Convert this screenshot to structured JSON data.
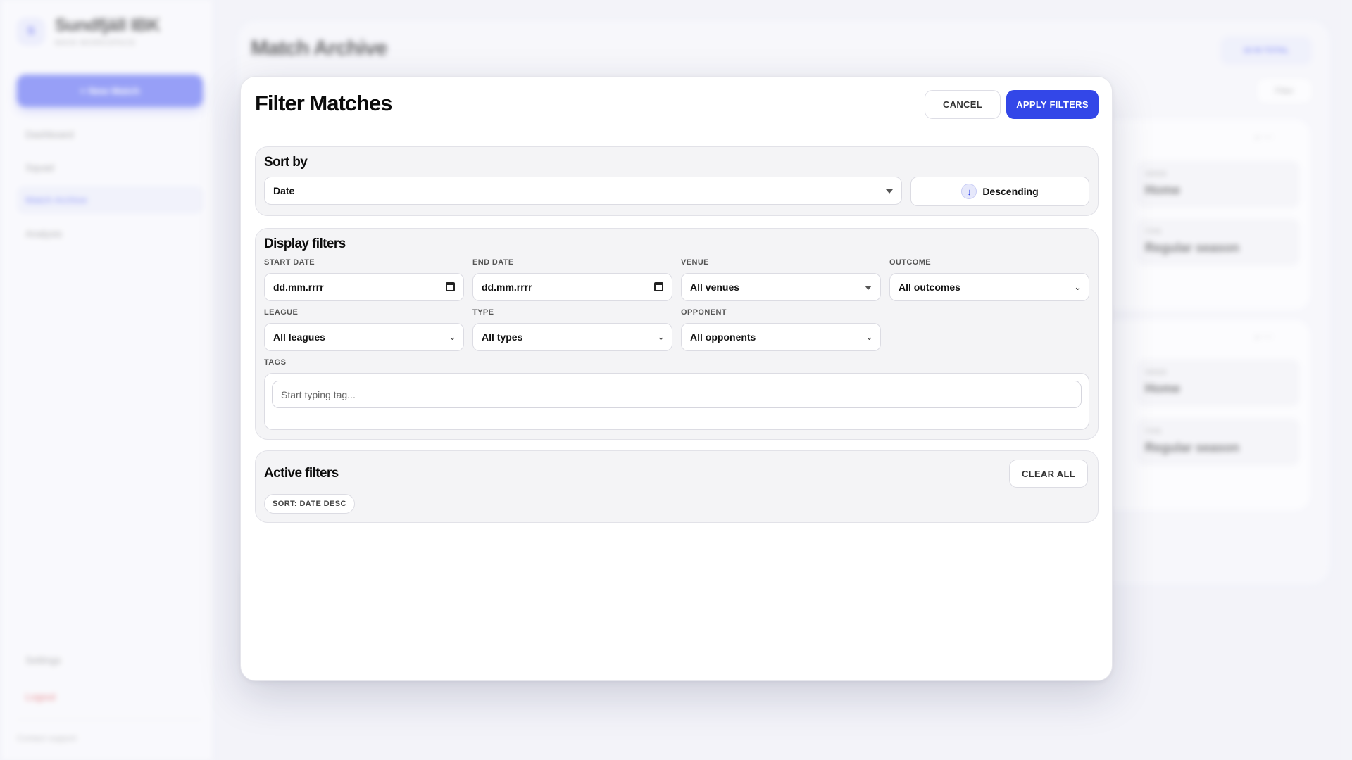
{
  "sidebar": {
    "brand_initial": "S",
    "brand_name": "Sundfjäll IBK",
    "brand_sub": "MAIN WORKSPACE",
    "new_match_label": "+ New Match",
    "nav": [
      "Dashboard",
      "Squad",
      "Match Archive",
      "Analysis"
    ],
    "settings_label": "Settings",
    "logout_label": "Logout",
    "support_label": "Contact support"
  },
  "background": {
    "title": "Match Archive",
    "total_badge": "16 IN TOTAL",
    "filter_label": "Filter",
    "cards": [
      {
        "venue_label": "VENUE",
        "venue": "Home",
        "type_label": "TYPE",
        "type": "Regular season"
      },
      {
        "venue_label": "VENUE",
        "venue": "Home",
        "type_label": "TYPE",
        "type": "Regular season"
      }
    ]
  },
  "modal": {
    "title": "Filter Matches",
    "cancel_label": "CANCEL",
    "apply_label": "APPLY FILTERS",
    "sort": {
      "title": "Sort by",
      "field_value": "Date",
      "direction_label": "Descending",
      "direction_icon": "↓"
    },
    "display": {
      "title": "Display filters",
      "start_date_label": "START DATE",
      "start_date_value": "dd.mm.rrrr",
      "end_date_label": "END DATE",
      "end_date_value": "dd.mm.rrrr",
      "venue_label": "VENUE",
      "venue_value": "All venues",
      "outcome_label": "OUTCOME",
      "outcome_value": "All outcomes",
      "league_label": "LEAGUE",
      "league_value": "All leagues",
      "type_label": "TYPE",
      "type_value": "All types",
      "opponent_label": "OPPONENT",
      "opponent_value": "All opponents",
      "tags_label": "TAGS",
      "tags_placeholder": "Start typing tag..."
    },
    "active": {
      "title": "Active filters",
      "clear_label": "CLEAR ALL",
      "chips": [
        "SORT: DATE DESC"
      ]
    }
  },
  "colors": {
    "accent": "#3347e8",
    "accent_soft": "#6471f4",
    "danger": "#e0585c"
  }
}
